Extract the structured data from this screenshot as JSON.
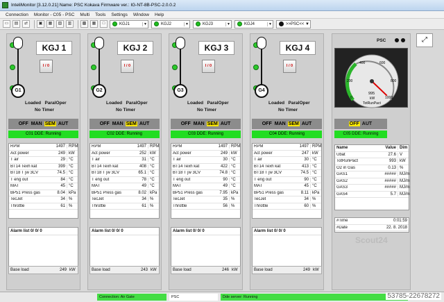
{
  "window": {
    "title": "InteliMonitor [3.12.0.21] Name: PSC Kokava Firmware ver.: IG-NT-8B-PSC-2.0.0.2"
  },
  "menu": [
    "Connection",
    "Monitor - C05 - PSC",
    "Multi",
    "Tools",
    "Settings",
    "Window",
    "Help"
  ],
  "toolbar": {
    "units": [
      "KGJ1",
      "KGJ2",
      "KGJ3",
      "KGJ4"
    ],
    "psc_label": ">>PSC<<"
  },
  "gensets": [
    {
      "name": "KGJ 1",
      "gen": "G1",
      "breaker": "I / 0",
      "state1": "Loaded",
      "state2": "ParalOper",
      "timer": "No Timer",
      "modes": [
        "OFF",
        "MAN",
        "SEM",
        "AUT"
      ],
      "active_mode": "SEM",
      "status": "C01 DDE: Running",
      "values": [
        [
          "RPM",
          "1497",
          "RPM"
        ],
        [
          "Act power",
          "249",
          "kW"
        ],
        [
          "T air",
          "29",
          "°C"
        ],
        [
          "BT14 Texh kat",
          "399",
          "°C"
        ],
        [
          "BT18 T jw 3CV",
          "74.5",
          "°C"
        ],
        [
          "T eng out",
          "84",
          "°C"
        ],
        [
          "MAT",
          "45",
          "°C"
        ],
        [
          "BP51 Press gas",
          "8.04",
          "kPa"
        ],
        [
          "TecJet",
          "34",
          "%"
        ],
        [
          "Throttle",
          "61",
          "%"
        ]
      ],
      "alarm": "Alarm list  0/ 0/ 0",
      "base_load": {
        "label": "Base load",
        "value": "249",
        "unit": "kW"
      }
    },
    {
      "name": "KGJ 2",
      "gen": "G2",
      "breaker": "I / 0",
      "state1": "Loaded",
      "state2": "ParalOper",
      "timer": "No Timer",
      "modes": [
        "OFF",
        "MAN",
        "SEM",
        "AUT"
      ],
      "active_mode": "SEM",
      "status": "C02 DDE: Running",
      "values": [
        [
          "RPM",
          "1497",
          "RPM"
        ],
        [
          "Act power",
          "252",
          "kW"
        ],
        [
          "T air",
          "31",
          "°C"
        ],
        [
          "BT14 Texh kat",
          "408",
          "°C"
        ],
        [
          "BT18 T jw 3CV",
          "65.1",
          "°C"
        ],
        [
          "T eng out",
          "78",
          "°C"
        ],
        [
          "MAT",
          "49",
          "°C"
        ],
        [
          "BP51 Press gas",
          "8.02",
          "kPa"
        ],
        [
          "TecJet",
          "34",
          "%"
        ],
        [
          "Throttle",
          "61",
          "%"
        ]
      ],
      "alarm": "Alarm list  0/ 0/ 0",
      "base_load": {
        "label": "Base load",
        "value": "243",
        "unit": "kW"
      }
    },
    {
      "name": "KGJ 3",
      "gen": "G3",
      "breaker": "I / 0",
      "state1": "Loaded",
      "state2": "ParalOper",
      "timer": "No Timer",
      "modes": [
        "OFF",
        "MAN",
        "SEM",
        "AUT"
      ],
      "active_mode": "SEM",
      "status": "C03 DDE: Running",
      "values": [
        [
          "RPM",
          "1497",
          "RPM"
        ],
        [
          "Act power",
          "249",
          "kW"
        ],
        [
          "T air",
          "30",
          "°C"
        ],
        [
          "BT14 Texh kat",
          "422",
          "°C"
        ],
        [
          "BT18 T jw 3CV",
          "74.8",
          "°C"
        ],
        [
          "T eng out",
          "90",
          "°C"
        ],
        [
          "MAT",
          "49",
          "°C"
        ],
        [
          "BP51 Press gas",
          "7.95",
          "kPa"
        ],
        [
          "TecJet",
          "35",
          "%"
        ],
        [
          "Throttle",
          "56",
          "%"
        ]
      ],
      "alarm": "Alarm list  0/ 0/ 0",
      "base_load": {
        "label": "Base load",
        "value": "246",
        "unit": "kW"
      }
    },
    {
      "name": "KGJ 4",
      "gen": "G4",
      "breaker": "I / 0",
      "state1": "Loaded",
      "state2": "ParalOper",
      "timer": "No Timer",
      "modes": [
        "OFF",
        "MAN",
        "SEM",
        "AUT"
      ],
      "active_mode": "SEM",
      "status": "C04 DDE: Running",
      "values": [
        [
          "RPM",
          "1497",
          "RPM"
        ],
        [
          "Act power",
          "247",
          "kW"
        ],
        [
          "T air",
          "30",
          "°C"
        ],
        [
          "BT14 Texh kat",
          "413",
          "°C"
        ],
        [
          "BT18 T jw 3CV",
          "74.5",
          "°C"
        ],
        [
          "T eng out",
          "90",
          "°C"
        ],
        [
          "MAT",
          "45",
          "°C"
        ],
        [
          "BP51 Press gas",
          "8.11",
          "kPa"
        ],
        [
          "TecJet",
          "34",
          "%"
        ],
        [
          "Throttle",
          "60",
          "%"
        ]
      ],
      "alarm": "Alarm list  0/ 0/ 0",
      "base_load": {
        "label": "Base load",
        "value": "249",
        "unit": "kW"
      }
    }
  ],
  "psc": {
    "label": "PSC",
    "gauge": {
      "ticks": [
        "0",
        "200",
        "400",
        "600",
        "800",
        "1000"
      ],
      "value": "995",
      "unit": "kW",
      "name": "TotRunPact",
      "reading": 995,
      "max": 1000
    },
    "modes": [
      "OFF",
      "AUT"
    ],
    "active_mode": "OFF",
    "status": "C05 DDE: Running",
    "header": [
      "Name",
      "Value",
      "Dim"
    ],
    "values": [
      [
        "Ubat",
        "27.6",
        "V"
      ],
      [
        "TotRunPact",
        "993",
        "kW"
      ],
      [
        "O2 in Gas",
        "0.13",
        "%"
      ],
      [
        "GAS1",
        "#####",
        "MJ/m"
      ],
      [
        "GAS2",
        "#####",
        "MJ/m"
      ],
      [
        "GAS3",
        "#####",
        "MJ/m"
      ],
      [
        "GAS4",
        "5.7",
        "MJ/m"
      ]
    ],
    "time": [
      [
        "#Time",
        "0:01:59"
      ],
      [
        "#Date",
        "22. 8. 2018"
      ]
    ],
    "watermark": "Scout24"
  },
  "statusbar": {
    "connection": "Connection: Air Gate",
    "unit": "PSC",
    "dde": "Dde server: Running",
    "ident": "53785-22678272"
  }
}
